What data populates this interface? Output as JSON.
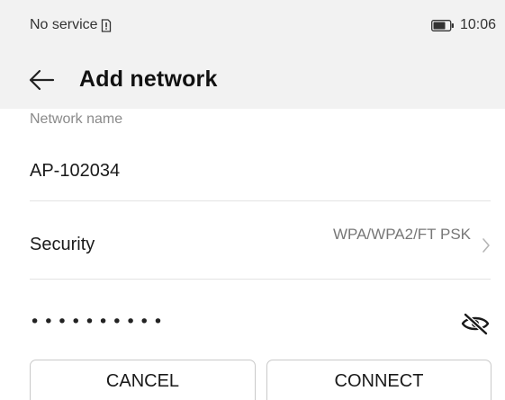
{
  "status_bar": {
    "carrier": "No service",
    "sim_icon": "sim-alert-icon",
    "battery_icon": "battery-icon",
    "time": "10:06"
  },
  "app_bar": {
    "back_icon": "arrow-left-icon",
    "title": "Add network"
  },
  "form": {
    "network_name_label": "Network name",
    "network_name_value": "AP-102034",
    "security_label": "Security",
    "security_value": "WPA/WPA2/FT PSK",
    "password_value": "••••••••••",
    "eye_icon": "eye-off-icon"
  },
  "actions": {
    "cancel_label": "CANCEL",
    "connect_label": "CONNECT"
  },
  "colors": {
    "header_bg": "#f2f2f2",
    "label_gray": "#8a8a8a",
    "divider": "#e3e3e3",
    "button_border": "#c9c9c9"
  }
}
